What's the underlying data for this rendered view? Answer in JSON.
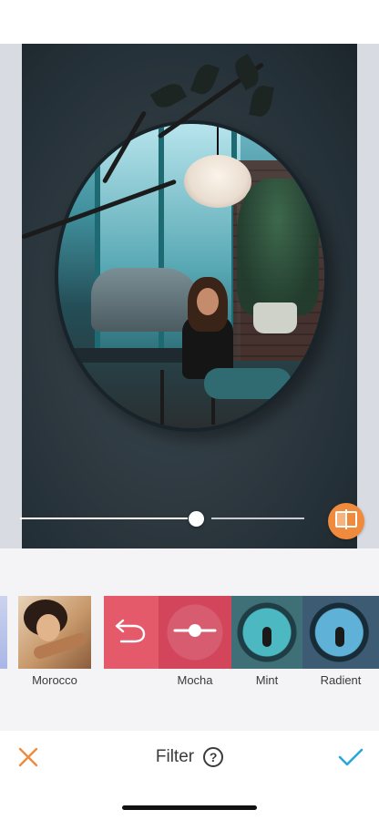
{
  "editor": {
    "intensity_fraction": 0.62
  },
  "filters": {
    "items": [
      {
        "label": "Morocco"
      },
      {
        "label": "Mocha"
      },
      {
        "label": "Mint"
      },
      {
        "label": "Radient"
      }
    ],
    "selected": "Mocha"
  },
  "toolbar": {
    "title": "Filter",
    "help_glyph": "?"
  },
  "icons": {
    "close": "close-icon",
    "confirm": "checkmark-icon",
    "help": "help-icon",
    "compare": "compare-icon",
    "undo": "undo-icon",
    "intensity": "intensity-slider-icon"
  },
  "colors": {
    "accent_orange": "#f08a3c",
    "confirm_blue": "#2aa7d8",
    "selected_filter": "#d2455b"
  }
}
